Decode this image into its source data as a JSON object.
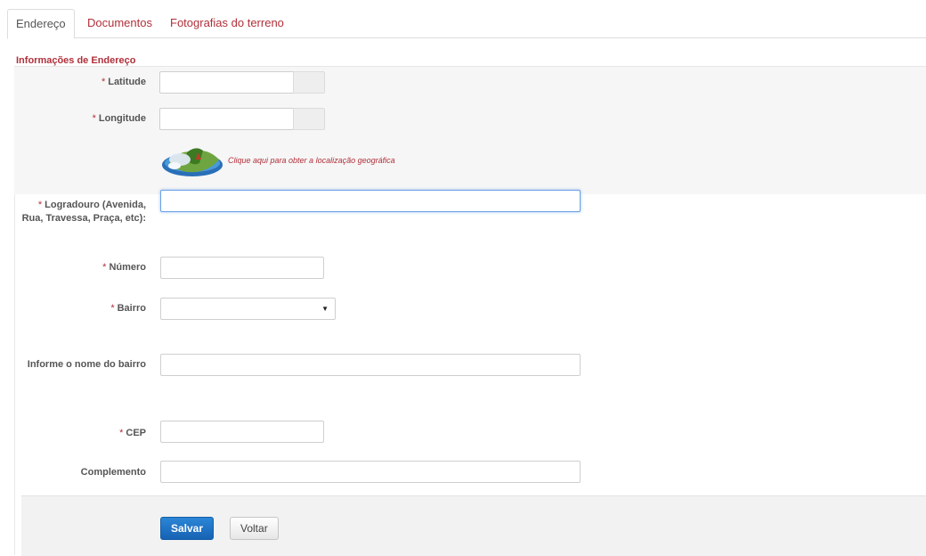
{
  "tabs": [
    {
      "label": "Endereço",
      "active": true
    },
    {
      "label": "Documentos",
      "active": false
    },
    {
      "label": "Fotografias do terreno",
      "active": false
    }
  ],
  "form": {
    "legend": "Informações de Endereço",
    "required_marker": "*",
    "latitude": {
      "label": "Latitude",
      "value": ""
    },
    "longitude": {
      "label": "Longitude",
      "value": ""
    },
    "map_link": {
      "text": "Clique aqui para obter a localização geográfica",
      "icon": "map-icon"
    },
    "logradouro": {
      "label": "Logradouro (Avenida, Rua, Travessa, Praça, etc):",
      "value": ""
    },
    "numero": {
      "label": "Número",
      "value": ""
    },
    "bairro": {
      "label": "Bairro",
      "selected": ""
    },
    "bairro_nome": {
      "label": "Informe o nome do bairro",
      "value": ""
    },
    "cep": {
      "label": "CEP",
      "value": ""
    },
    "complemento": {
      "label": "Complemento",
      "value": ""
    }
  },
  "buttons": {
    "save": "Salvar",
    "back": "Voltar"
  },
  "colors": {
    "accent": "#b0303a",
    "primary_button": "#1f73c5",
    "focus_border": "#6aa1e6"
  }
}
